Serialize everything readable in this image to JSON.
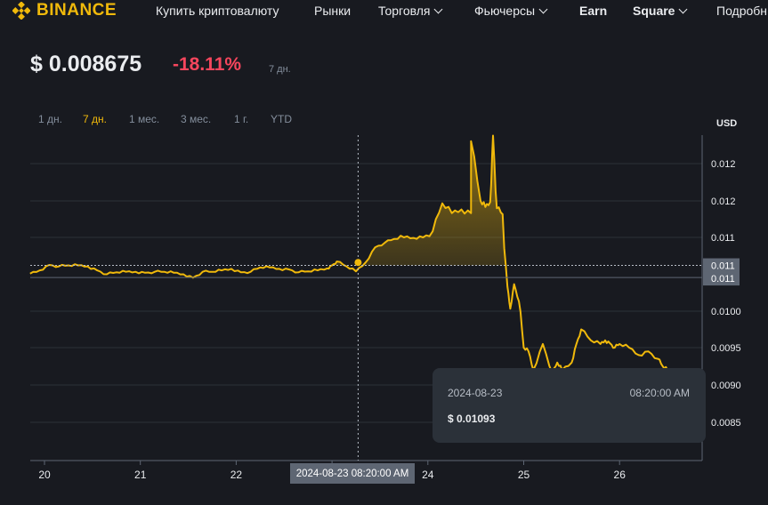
{
  "nav": {
    "brand": "BINANCE",
    "items": [
      {
        "label": "Купить криптовалюту",
        "dropdown": false,
        "bold": false
      },
      {
        "label": "Рынки",
        "dropdown": false,
        "bold": false
      },
      {
        "label": "Торговля",
        "dropdown": true,
        "bold": false
      },
      {
        "label": "Фьючерсы",
        "dropdown": true,
        "bold": false
      },
      {
        "label": "Earn",
        "dropdown": false,
        "bold": true
      },
      {
        "label": "Square",
        "dropdown": true,
        "bold": true
      },
      {
        "label": "Подробн",
        "dropdown": false,
        "bold": false
      }
    ]
  },
  "header": {
    "price": "$ 0.008675",
    "change": "-18.11%",
    "period": "7 дн."
  },
  "ranges": [
    {
      "label": "1 дн.",
      "active": false
    },
    {
      "label": "7 дн.",
      "active": true
    },
    {
      "label": "1 мес.",
      "active": false
    },
    {
      "label": "3 мес.",
      "active": false
    },
    {
      "label": "1 г.",
      "active": false
    },
    {
      "label": "YTD",
      "active": false
    }
  ],
  "colors": {
    "accent": "#f0b90b",
    "negative": "#f6465d",
    "background": "#181a20",
    "panel": "#2b3139"
  },
  "chart_data": {
    "type": "area",
    "unit_label": "USD",
    "y_ticks": [
      0.012,
      0.0118,
      0.0115,
      0.01,
      0.0095,
      0.009,
      0.0085
    ],
    "y_tick_labels": [
      "0.012",
      "0.012",
      "0.011",
      "0.0100",
      "0.0095",
      "0.0090",
      "0.0085"
    ],
    "x_ticks": [
      20,
      21,
      22,
      23,
      24,
      25,
      26
    ],
    "x_tick_labels": [
      "20",
      "21",
      "22",
      "23",
      "24",
      "25",
      "26"
    ],
    "xlim": [
      19.85,
      26.85
    ],
    "ylim": [
      0.0081,
      0.0125
    ],
    "reference_price": 0.01093,
    "reference_label": "0.011",
    "last_price_label": "0.011",
    "last_price": 0.010685,
    "series": [
      {
        "x": [
          19.85,
          19.95,
          20.05,
          20.15,
          20.25,
          20.35,
          20.45,
          20.55,
          20.65,
          20.75,
          20.85,
          20.95,
          21.05,
          21.15,
          21.25,
          21.35,
          21.45,
          21.55,
          21.65,
          21.75,
          21.85,
          21.95,
          22.05,
          22.15,
          22.25,
          22.35,
          22.45,
          22.55,
          22.65,
          22.75,
          22.85,
          22.95,
          23.0,
          23.05,
          23.15,
          23.25,
          23.35,
          23.45,
          23.55,
          23.65,
          23.75,
          23.85,
          23.95,
          24.05,
          24.15,
          24.25,
          24.35,
          24.45,
          24.55,
          24.6,
          24.65,
          24.72,
          24.78,
          24.83,
          24.86,
          24.9,
          24.95,
          25.0,
          25.05,
          25.1,
          25.2,
          25.3,
          25.35,
          25.4,
          25.5,
          25.55,
          25.6,
          25.7,
          25.8,
          25.85,
          25.9,
          25.95,
          26.0,
          26.1,
          26.2,
          26.3,
          26.4,
          26.45,
          26.5,
          26.55
        ],
        "y": [
          0.010765,
          0.01083,
          0.01094,
          0.01091,
          0.01093,
          0.01093,
          0.01091,
          0.01083,
          0.01075,
          0.01079,
          0.0108,
          0.0108,
          0.01078,
          0.0108,
          0.0108,
          0.01078,
          0.01075,
          0.01068,
          0.0108,
          0.0108,
          0.01083,
          0.01086,
          0.01079,
          0.0108,
          0.01089,
          0.01089,
          0.01086,
          0.01085,
          0.01079,
          0.01081,
          0.01083,
          0.01087,
          0.01093,
          0.01101,
          0.01091,
          0.01081,
          0.01099,
          0.0113,
          0.01139,
          0.01147,
          0.0115,
          0.01149,
          0.0115,
          0.01155,
          0.01178,
          0.0117,
          0.01173,
          0.0117,
          0.0118,
          0.01175,
          0.01179,
          0.01174,
          0.01169,
          0.0105,
          0.01005,
          0.01055,
          0.0102,
          0.0095,
          0.00945,
          0.0092,
          0.00955,
          0.00915,
          0.0093,
          0.0092,
          0.0093,
          0.00955,
          0.00975,
          0.0096,
          0.00955,
          0.0096,
          0.00956,
          0.0095,
          0.00955,
          0.0095,
          0.0094,
          0.00945,
          0.00935,
          0.00925,
          0.0092,
          0.00905
        ],
        "spikes": [
          [
            24.45,
            0.01212
          ],
          [
            24.68,
            0.01215
          ]
        ]
      }
    ],
    "hover": {
      "x": 23.3,
      "x_label": "2024-08-23 08:20:00 AM",
      "date": "2024-08-23",
      "time": "08:20:00 AM",
      "value": "$ 0.01093"
    }
  }
}
